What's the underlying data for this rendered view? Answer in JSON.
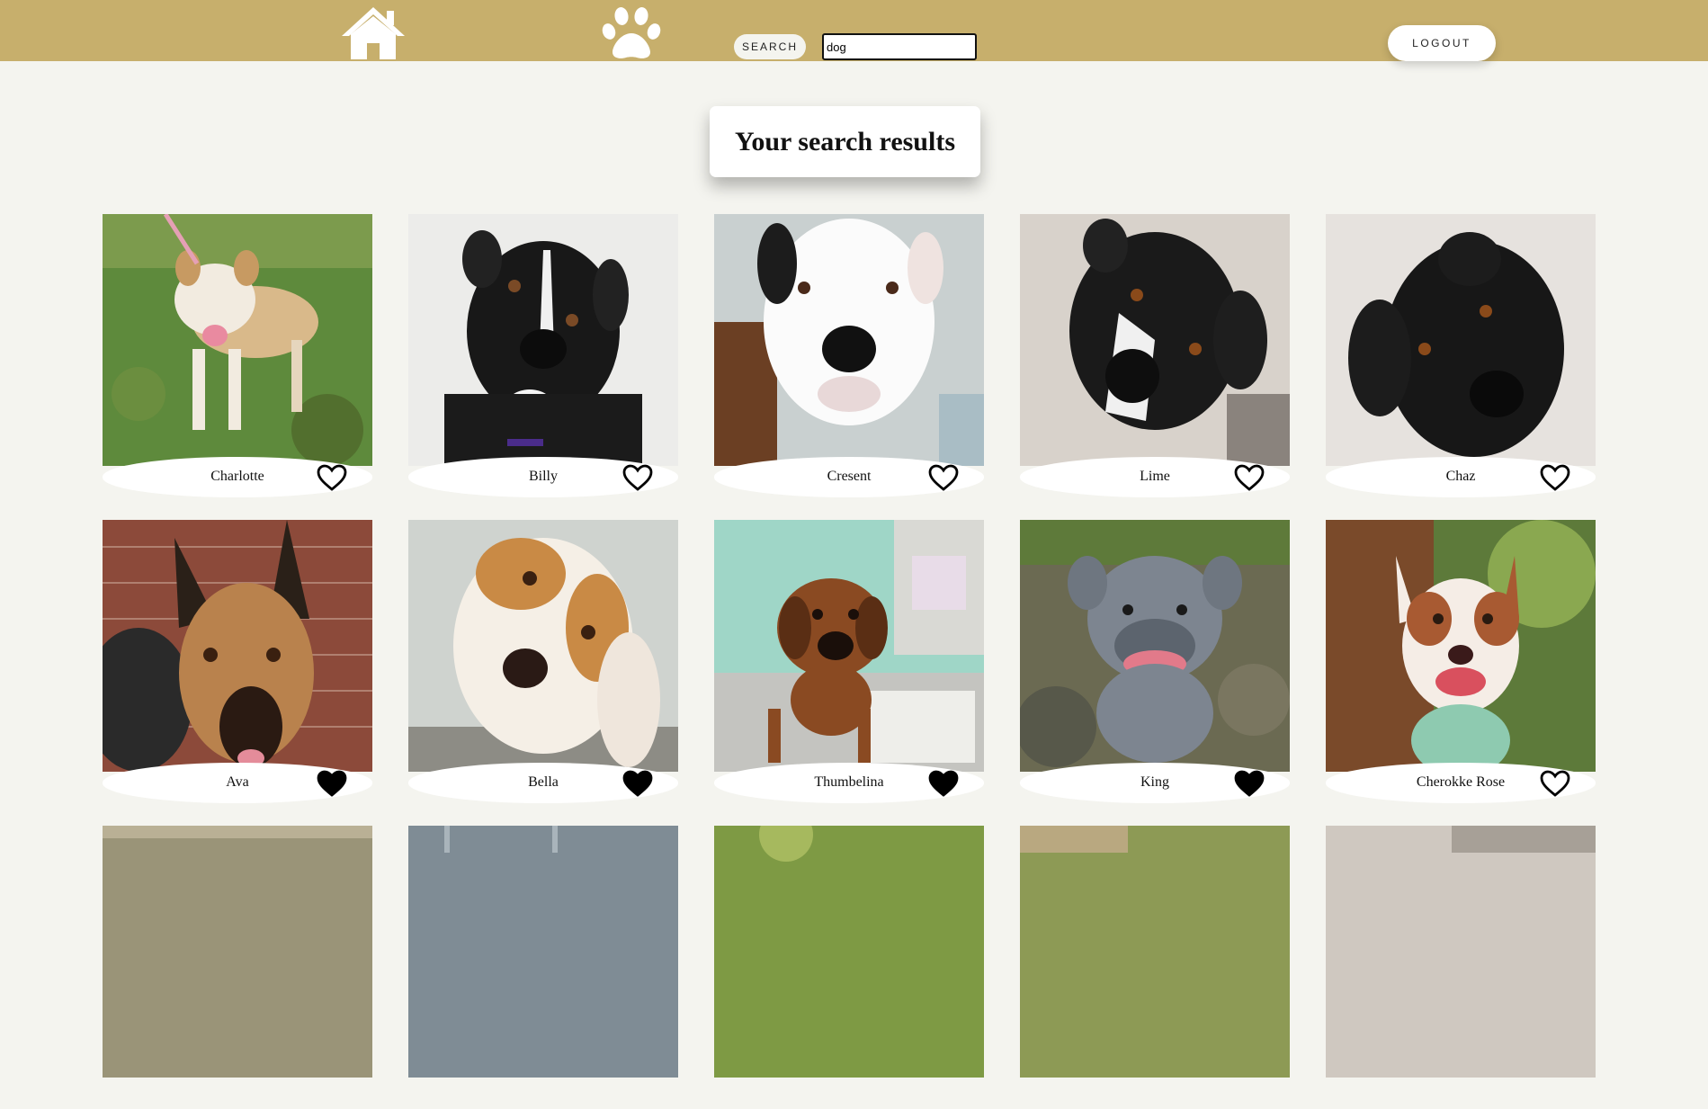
{
  "header": {
    "home_icon": "home-icon",
    "paw_icon": "paw-icon",
    "search_label": "SEARCH",
    "search_value": "dog",
    "logout_label": "LOGOUT"
  },
  "page": {
    "heading": "Your search results"
  },
  "colors": {
    "header_bg": "#c7af6c",
    "page_bg": "#f4f4ef",
    "card_label_bg": "#ffffff"
  },
  "pets": [
    {
      "name": "Charlotte",
      "favorited": false
    },
    {
      "name": "Billy",
      "favorited": false
    },
    {
      "name": "Cresent",
      "favorited": false
    },
    {
      "name": "Lime",
      "favorited": false
    },
    {
      "name": "Chaz",
      "favorited": false
    },
    {
      "name": "Ava",
      "favorited": true
    },
    {
      "name": "Bella",
      "favorited": true
    },
    {
      "name": "Thumbelina",
      "favorited": true
    },
    {
      "name": "King",
      "favorited": true
    },
    {
      "name": "Cherokke Rose",
      "favorited": false
    }
  ]
}
